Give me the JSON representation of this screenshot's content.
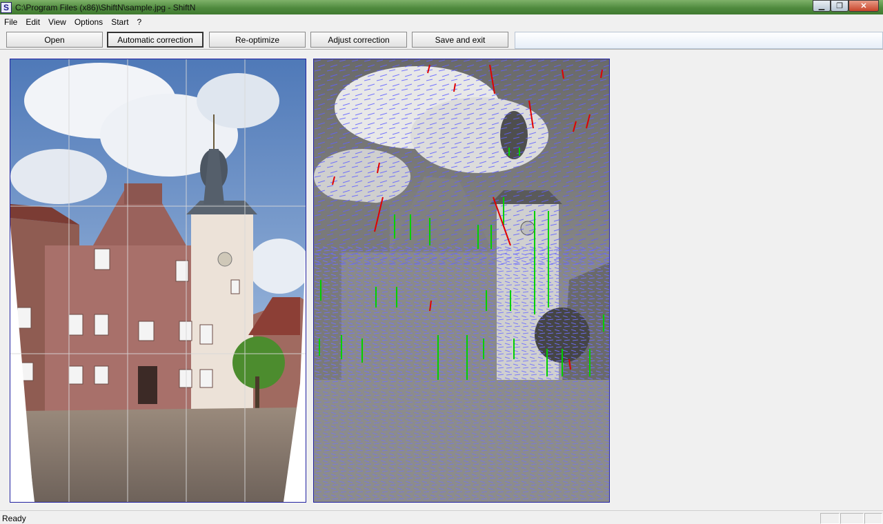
{
  "window": {
    "app_letter": "S",
    "title": "C:\\Program Files (x86)\\ShiftN\\sample.jpg - ShiftN",
    "min_icon": "minimize-icon",
    "max_icon": "restore-icon",
    "close_icon": "close-icon"
  },
  "menu": [
    "File",
    "Edit",
    "View",
    "Options",
    "Start",
    "?"
  ],
  "toolbar": {
    "open": "Open",
    "automatic_correction": "Automatic correction",
    "reoptimize": "Re-optimize",
    "adjust_correction": "Adjust correction",
    "save_exit": "Save and exit"
  },
  "status": {
    "text": "Ready"
  },
  "colors": {
    "panel_border": "#2020a0",
    "edge_blue": "#6060ff",
    "edge_green": "#00d000",
    "edge_red": "#e00000"
  }
}
